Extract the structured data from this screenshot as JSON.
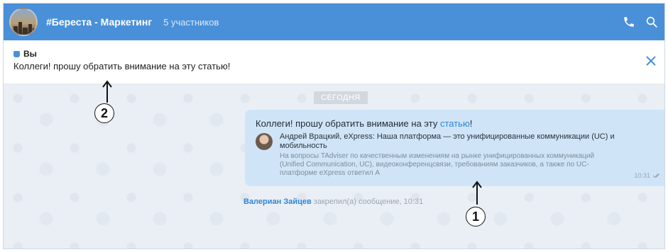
{
  "header": {
    "channel_name": "#Береста - Маркетинг",
    "members": "5 участников",
    "icons": [
      "phone-icon",
      "search-icon"
    ]
  },
  "pinned": {
    "author": "Вы",
    "text": "Коллеги! прошу обратить внимание на эту статью!"
  },
  "chat": {
    "date_label": "СЕГОДНЯ",
    "message": {
      "text_before_link": "Коллеги! прошу обратить внимание на эту ",
      "link_text": "статью",
      "text_after_link": "!",
      "preview_title": "Андрей Врацкий, eXpress: Наша платформа — это унифицированные коммуникации (UC) и мобильность",
      "preview_desc": "На вопросы TAdviser по качественным изменениям на рынке унифицированных коммуникаций (Unified Communication, UC), видеоконференцсвязи, требованиям заказчиков, а также по UC-платформе eXpress ответил А",
      "time": "10:31"
    },
    "system": {
      "who": "Валериан Зайцев",
      "rest": "закрепил(а) сообщение, 10:31"
    }
  },
  "annotations": {
    "label_1": "1",
    "label_2": "2"
  }
}
